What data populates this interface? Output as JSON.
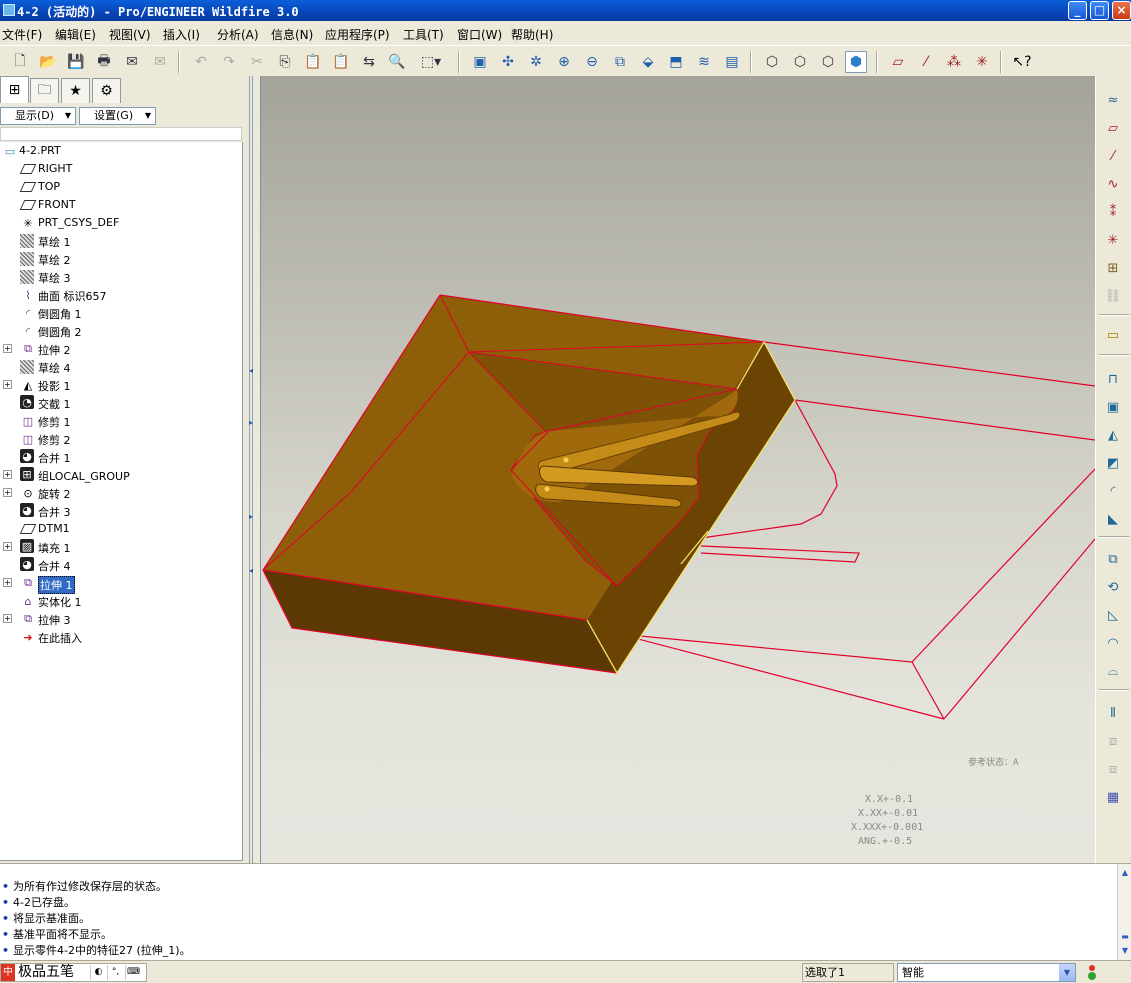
{
  "window": {
    "title": "4-2 (活动的) - Pro/ENGINEER Wildfire 3.0",
    "min_glyph": "_",
    "max_glyph": "□",
    "close_glyph": "×"
  },
  "menu": [
    {
      "label": "文件(F)"
    },
    {
      "label": "编辑(E)"
    },
    {
      "label": "视图(V)"
    },
    {
      "label": "插入(I)"
    },
    {
      "label": "分析(A)"
    },
    {
      "label": "信息(N)"
    },
    {
      "label": "应用程序(P)"
    },
    {
      "label": "工具(T)"
    },
    {
      "label": "窗口(W)"
    },
    {
      "label": "帮助(H)"
    }
  ],
  "toolbar": {
    "icons": [
      "new-icon",
      "open-icon",
      "save-icon",
      "print-icon",
      "email-icon",
      "email-link-icon",
      "undo-icon",
      "redo-icon",
      "cut-icon",
      "copy-icon",
      "paste-icon",
      "paste-special-icon",
      "regenerate-icon",
      "find-icon",
      "select-box-icon",
      "repaint-icon",
      "spin-center-icon",
      "orient-mode-icon",
      "zoom-in-icon",
      "zoom-out-icon",
      "refit-icon",
      "reorient-icon",
      "saved-views-icon",
      "layers-icon",
      "view-manager-icon",
      "wireframe-icon",
      "hidden-line-icon",
      "no-hidden-icon",
      "shading-icon",
      "datum-planes-icon",
      "datum-axes-icon",
      "datum-points-icon",
      "coordinate-systems-icon",
      "context-help-icon"
    ]
  },
  "left_panel": {
    "tabs": [
      "model-tree-tab",
      "folder-browser-tab",
      "favorites-tab",
      "connections-tab"
    ],
    "show_button": "显示(D)",
    "settings_button": "设置(G)",
    "tree": [
      {
        "label": "4-2.PRT",
        "icon": "part-icon",
        "expandable": false,
        "level": 0
      },
      {
        "label": "RIGHT",
        "icon": "datum-plane-icon",
        "expandable": false,
        "level": 1
      },
      {
        "label": "TOP",
        "icon": "datum-plane-icon",
        "expandable": false,
        "level": 1
      },
      {
        "label": "FRONT",
        "icon": "datum-plane-icon",
        "expandable": false,
        "level": 1
      },
      {
        "label": "PRT_CSYS_DEF",
        "icon": "csys-icon",
        "expandable": false,
        "level": 1
      },
      {
        "label": "草绘 1",
        "icon": "sketch-icon",
        "expandable": false,
        "level": 1
      },
      {
        "label": "草绘 2",
        "icon": "sketch-icon",
        "expandable": false,
        "level": 1
      },
      {
        "label": "草绘 3",
        "icon": "sketch-icon",
        "expandable": false,
        "level": 1
      },
      {
        "label": "曲面 标识657",
        "icon": "surface-icon",
        "expandable": false,
        "level": 1
      },
      {
        "label": "倒圆角 1",
        "icon": "round-icon",
        "expandable": false,
        "level": 1
      },
      {
        "label": "倒圆角 2",
        "icon": "round-icon",
        "expandable": false,
        "level": 1
      },
      {
        "label": "拉伸 2",
        "icon": "extrude-icon",
        "expandable": true,
        "level": 1
      },
      {
        "label": "草绘 4",
        "icon": "sketch-icon",
        "expandable": false,
        "level": 1
      },
      {
        "label": "投影 1",
        "icon": "projection-icon",
        "expandable": true,
        "level": 1
      },
      {
        "label": "交截 1",
        "icon": "intersect-icon",
        "expandable": false,
        "level": 1
      },
      {
        "label": "修剪 1",
        "icon": "trim-icon",
        "expandable": false,
        "level": 1
      },
      {
        "label": "修剪 2",
        "icon": "trim-icon",
        "expandable": false,
        "level": 1
      },
      {
        "label": "合并 1",
        "icon": "merge-icon",
        "expandable": false,
        "level": 1
      },
      {
        "label": "组LOCAL_GROUP",
        "icon": "group-icon",
        "expandable": true,
        "level": 1
      },
      {
        "label": "旋转 2",
        "icon": "revolve-icon",
        "expandable": true,
        "level": 1
      },
      {
        "label": "合并 3",
        "icon": "merge-icon",
        "expandable": false,
        "level": 1
      },
      {
        "label": "DTM1",
        "icon": "datum-plane-icon",
        "expandable": false,
        "level": 1
      },
      {
        "label": "填充 1",
        "icon": "fill-icon",
        "expandable": true,
        "level": 1
      },
      {
        "label": "合并 4",
        "icon": "merge-icon",
        "expandable": false,
        "level": 1
      },
      {
        "label": "拉伸 1",
        "icon": "extrude-icon",
        "expandable": true,
        "level": 1,
        "selected": true
      },
      {
        "label": "实体化 1",
        "icon": "solidify-icon",
        "expandable": false,
        "level": 1
      },
      {
        "label": "拉伸 3",
        "icon": "extrude-icon",
        "expandable": true,
        "level": 1
      },
      {
        "label": "在此插入",
        "icon": "insert-here-arrow-icon",
        "expandable": false,
        "level": 1
      }
    ]
  },
  "viewport": {
    "model_colors": {
      "top_face": "#8f5e08",
      "side_face": "#6b4303",
      "front_face": "#5c3904",
      "edge_highlight": "#f5e36a",
      "datum_edges": "#e3002a"
    },
    "tolerance_status": "参考状态：A",
    "tolerances": [
      "X.X+-0.1",
      "X.XX+-0.01",
      "X.XXX+-0.001",
      "ANG.+-0.5"
    ]
  },
  "right_toolbar": {
    "icons": [
      "sketched-datum-curve-icon",
      "datum-plane-tool-icon",
      "datum-axis-tool-icon",
      "datum-curve-tool-icon",
      "datum-point-tool-icon",
      "csys-tool-icon",
      "analysis-feature-icon",
      "datum-chain-icon",
      "annotation-feature-icon",
      "hole-tool-icon",
      "shell-tool-icon",
      "rib-tool-icon",
      "draft-tool-icon",
      "round-tool-icon",
      "chamfer-tool-icon",
      "extrude-tool-icon",
      "revolve-tool-icon",
      "sweep-tool-icon",
      "blend-tool-icon",
      "style-tool-icon",
      "mirror-tool-icon",
      "merge-tool-icon",
      "trim-tool-icon",
      "pattern-tool-icon"
    ]
  },
  "messages": [
    "为所有作过修改保存层的状态。",
    "4-2已存盘。",
    "将显示基准面。",
    "基准平面将不显示。",
    "显示零件4-2中的特征27 (拉伸_1)。"
  ],
  "status": {
    "ime_name": "极品五笔",
    "selection": "选取了1",
    "filter": "智能"
  }
}
